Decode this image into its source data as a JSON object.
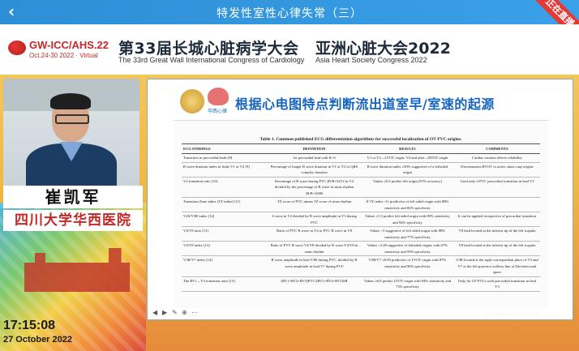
{
  "topbar": {
    "back": "‹",
    "title": "特发性室性心律失常（三）",
    "live": "正在直播"
  },
  "banner": {
    "logo_name": "GW-ICC/AHS.22",
    "logo_date": "Oct.24-30 2022 · Virtual",
    "cn_title": "第33届长城心脏病学大会",
    "en_title": "The 33rd Great Wall International Congress of Cardiology",
    "cn_title2": "亚洲心脏大会2022",
    "en_title2": "Asia Heart Society Congress 2022"
  },
  "speaker": {
    "name": "崔凯军",
    "hospital": "四川大学华西医院"
  },
  "clock": {
    "time": "17:15:08",
    "date": "27 October 2022"
  },
  "slide": {
    "logo_text": "华西心律",
    "title": "根据心电图特点判断流出道室早/室速的起源",
    "table_caption": "Table 1. Common published ECG differentiation algorithms for successful localization of OT PVC origins.",
    "headers": [
      "ECG FINDINGS",
      "DEFINITION",
      "RESULTS",
      "COMMENTS"
    ],
    "rows": [
      [
        "Transition in precordial leads [8]",
        "1st precordial lead with R>S",
        "V1 or V2→LVOT origin; V4 and after→RVOT origin",
        "Cardiac rotation affects reliability"
      ],
      [
        "R wave duration index in leads V1 or V2 [9]",
        "Percentage of longer R wave duration in V1 or V2 to QRS complex duration",
        "R wave duration index ≥50% suggestive of a leftsided origin",
        "Discriminates RVOT vs aortic sinus cusp origins"
      ],
      [
        "V2 transition ratio [10]",
        "Percentage of R wave during PVC (R/R+S)V2 in V2 divided by the percentage of R wave in sinus rhythm (R/R+S)SR",
        "Values ≥0.6 predict left origin (91% accuracy)",
        "Used only if PVC precordial transition in lead V3"
      ],
      [
        "Transition Zone index (TZ index) [11]",
        "TZ score of PVC minus TZ score of sinus rhythm",
        "If TZ index <0, predictive of left sided origin with 88% sensitivity and 82% specificity",
        ""
      ],
      [
        "V2S/V3R index [12]",
        "S wave in V2 divided by R wave amplitude in V3 during PVC",
        "Values ≤1.5 predict left sided origin with 89% sensitivity and 94% specificity",
        "It can be applied irrespective of precordial transition"
      ],
      [
        "V4/V8 ratio [13]",
        "Ratio of PVC R wave in V4 to PVC R wave in V8",
        "Values >3 suggestive of left sided origin with 88% sensitivity and 77% specificity",
        "V8 lead located at the inferior tip of the left scapula"
      ],
      [
        "V4/V8 index [13]",
        "Ratio of PVC R wave V4/V8 divided by R wave V4/V8 in sinus rhythm",
        "Values >2.28 suggestive of leftsided origins with 67% sensitivity and 59% specificity",
        "V8 lead located at the inferior tip of the left scapula"
      ],
      [
        "V3R/V7 index [14]",
        "R wave amplitude in lead V3R during PVC, divided by R wave amplitude in lead V7 during PVC",
        "V3R/V7 ≥0.85 predictive of LVOT origin with 87% sensitivity and 96% specificity",
        "V3R located at the right correspondent place of V3 and V7 at the left posterior axillary line at 5th intercostal space"
      ],
      [
        "The RV1→V3 transition ratio [15]",
        "(RV1+RV2+RV3)PVC/(RV1+RV2+RV3)SR",
        "Values ≥0.9 predict LVOT origin with 94% sensitivity and 73% specificity",
        "Only for OT PVCs with precordial transition in lead V3"
      ]
    ],
    "footnote": "Rev. Cardiovasc. Med. 2022, 23(5), 169"
  }
}
